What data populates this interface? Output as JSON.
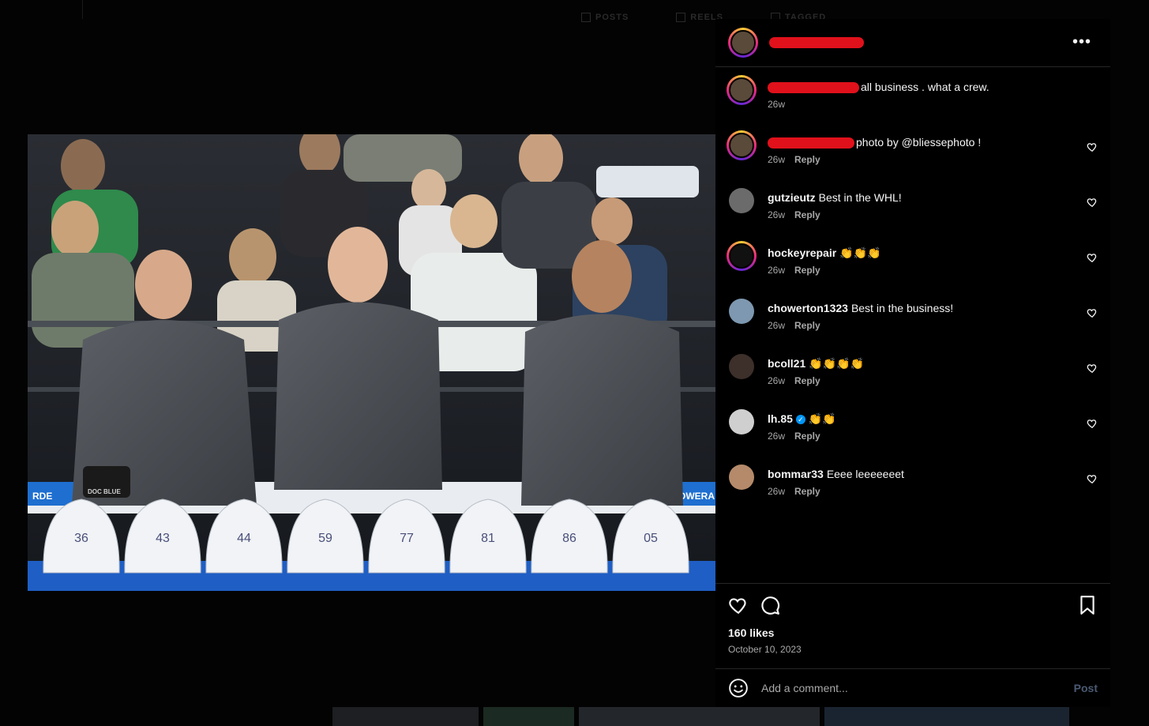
{
  "background": {
    "tabs": [
      "POSTS",
      "REELS",
      "TAGGED"
    ]
  },
  "photo": {
    "helmet_numbers": [
      "36",
      "43",
      "44",
      "59",
      "77",
      "81",
      "86",
      "05"
    ],
    "sign_left": "RDE",
    "sign_right": "POWERA",
    "cap_text": "DOC BLUE"
  },
  "post_header": {
    "more_icon": "more-horizontal-icon"
  },
  "comments": [
    {
      "user": "",
      "text": "all business . what a crew.",
      "time": "26w",
      "reply": "",
      "avatar_color": "#5a4a3a",
      "ring": true,
      "redacted": true
    },
    {
      "user": "",
      "text": "photo by @bliessephoto !",
      "time": "26w",
      "reply": "Reply",
      "avatar_color": "#5a4a3a",
      "ring": true,
      "redacted": true
    },
    {
      "user": "gutzieutz",
      "text": "Best in the WHL!",
      "time": "26w",
      "reply": "Reply",
      "avatar_color": "#6b6b6b"
    },
    {
      "user": "hockeyrepair",
      "text": "👏👏👏",
      "time": "26w",
      "reply": "Reply",
      "avatar_color": "#111111",
      "ring": true
    },
    {
      "user": "chowerton1323",
      "text": "Best in the business!",
      "time": "26w",
      "reply": "Reply",
      "avatar_color": "#7d98b0"
    },
    {
      "user": "bcoll21",
      "text": "👏👏👏👏",
      "time": "26w",
      "reply": "Reply",
      "avatar_color": "#3d2f2a"
    },
    {
      "user": "lh.85",
      "verified": true,
      "text": "👏👏",
      "time": "26w",
      "reply": "Reply",
      "avatar_color": "#cfcfcf"
    },
    {
      "user": "bommar33",
      "text": "Eeee leeeeeeet",
      "time": "26w",
      "reply": "Reply",
      "avatar_color": "#b48a6a"
    }
  ],
  "actions": {
    "likes": "160 likes",
    "date": "October 10, 2023",
    "comment_placeholder": "Add a comment...",
    "post_label": "Post"
  },
  "colors": {
    "accent_blue": "#0095f6",
    "post_disabled": "#4b5a73",
    "border": "#262626",
    "muted": "#a8a8a8"
  }
}
